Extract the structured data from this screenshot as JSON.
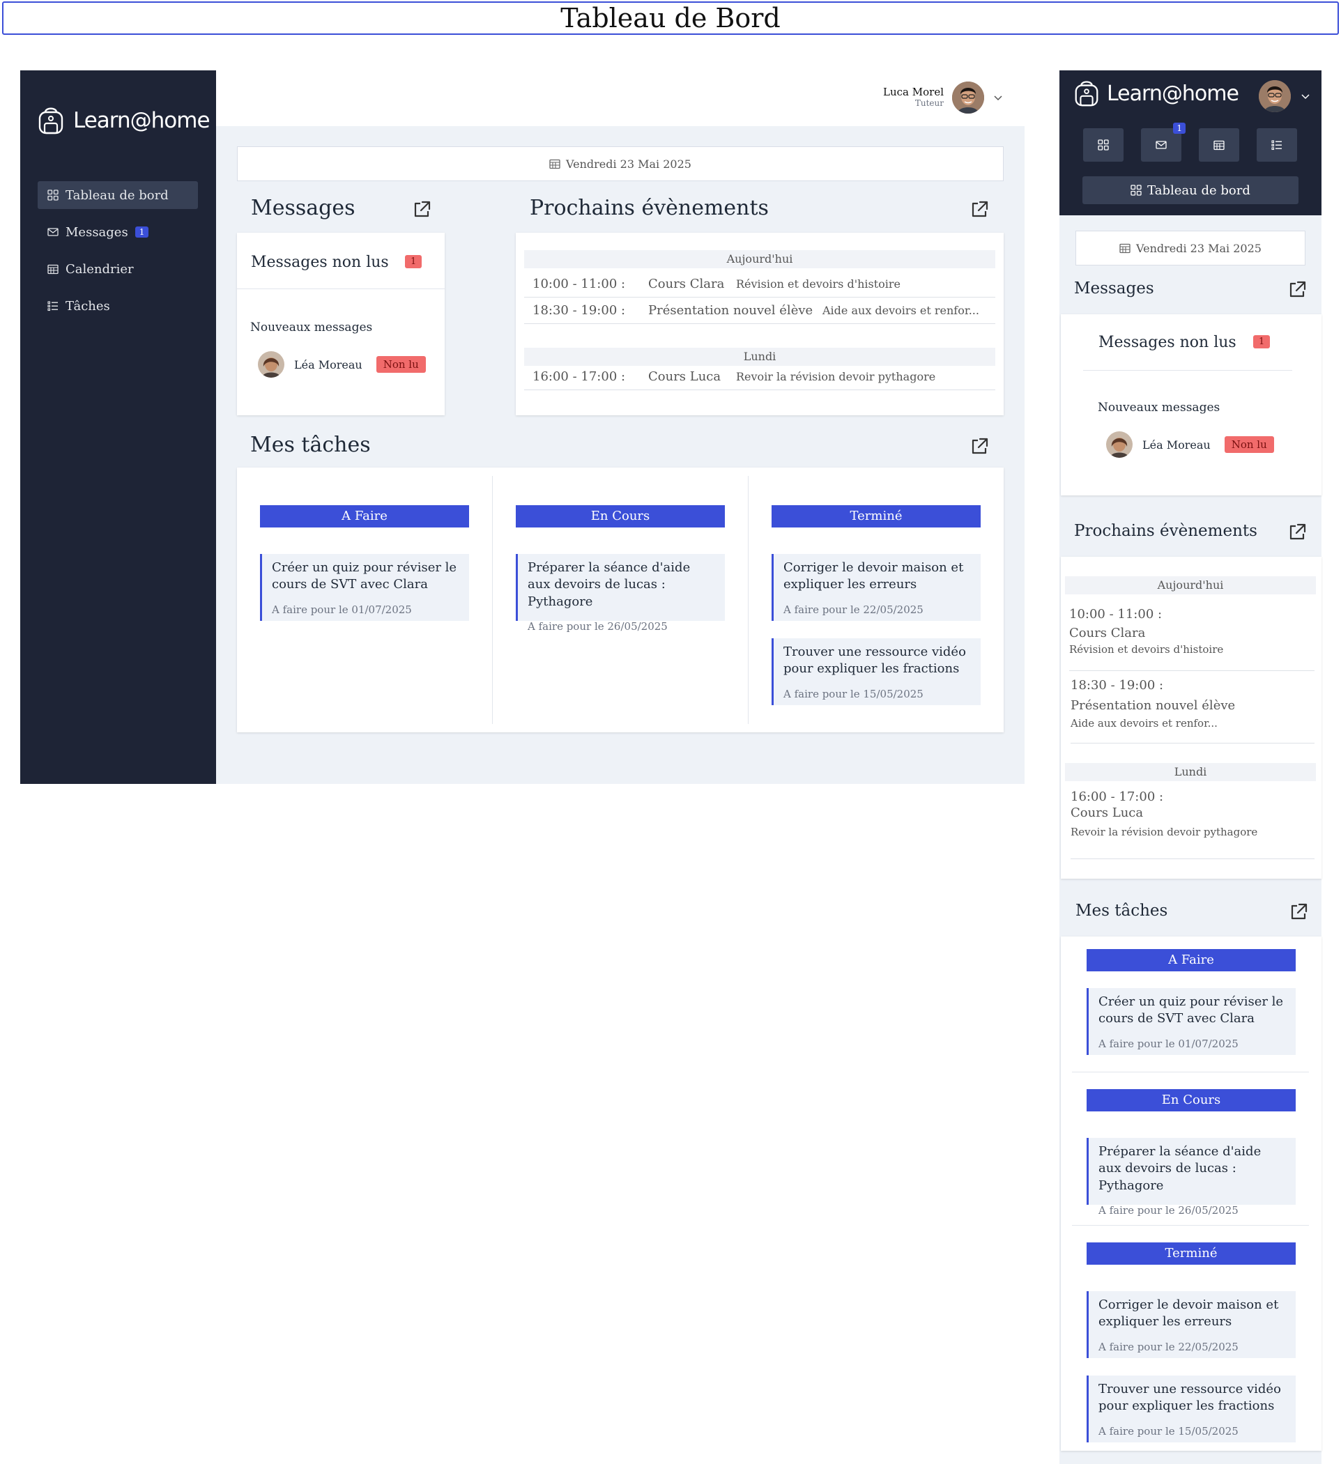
{
  "banner": {
    "title": "Tableau de Bord"
  },
  "brand": {
    "name": "Learn@home"
  },
  "sidebar": {
    "items": [
      {
        "label": "Tableau de bord",
        "icon": "grid-icon",
        "active": true
      },
      {
        "label": "Messages",
        "icon": "mail-icon",
        "badge": "1"
      },
      {
        "label": "Calendrier",
        "icon": "calendar-icon"
      },
      {
        "label": "Tâches",
        "icon": "list-icon"
      }
    ]
  },
  "user": {
    "name": "Luca Morel",
    "role": "Tuteur"
  },
  "date": "Vendredi 23 Mai 2025",
  "messages": {
    "title": "Messages",
    "unread_label": "Messages non lus",
    "unread_count": "1",
    "new_label": "Nouveaux messages",
    "items": [
      {
        "sender": "Léa Moreau",
        "status": "Non lu"
      }
    ]
  },
  "events": {
    "title": "Prochains évènements",
    "groups": [
      {
        "day": "Aujourd'hui",
        "items": [
          {
            "time": "10:00 - 11:00 :",
            "course": "Cours Clara",
            "desc": "Révision et devoirs d'histoire"
          },
          {
            "time": "18:30 - 19:00 :",
            "course": "Présentation nouvel élève",
            "desc": "Aide aux devoirs et renfor..."
          }
        ]
      },
      {
        "day": "Lundi",
        "items": [
          {
            "time": "16:00 - 17:00 :",
            "course": "Cours Luca",
            "desc": "Revoir la révision devoir pythagore"
          }
        ]
      }
    ]
  },
  "tasks": {
    "title": "Mes tâches",
    "columns": [
      {
        "name": "A Faire",
        "items": [
          {
            "title": "Créer un quiz pour réviser le cours de SVT avec Clara",
            "due": "A faire pour le 01/07/2025"
          }
        ]
      },
      {
        "name": "En Cours",
        "items": [
          {
            "title": "Préparer la séance d'aide aux devoirs de lucas : Pythagore",
            "due": "A faire pour le 26/05/2025"
          }
        ]
      },
      {
        "name": "Terminé",
        "items": [
          {
            "title": "Corriger le devoir maison et expliquer les erreurs",
            "due": "A faire pour le 22/05/2025"
          },
          {
            "title": "Trouver une ressource vidéo pour expliquer les fractions",
            "due": "A faire pour le 15/05/2025"
          }
        ]
      }
    ]
  },
  "mobile": {
    "active_label": "Tableau de bord",
    "messages_badge": "1"
  },
  "colors": {
    "sidebar": "#1e2436",
    "accent": "#3b4fd8",
    "danger": "#f16b6b",
    "bg": "#eef2f7"
  }
}
